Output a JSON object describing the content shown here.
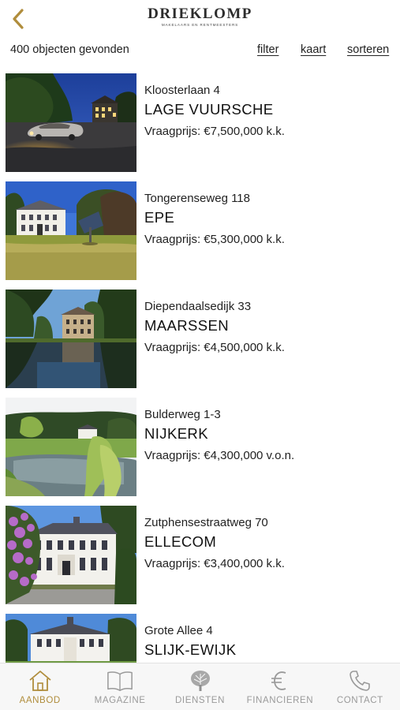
{
  "header": {
    "back_icon": "chevron-left-icon",
    "logo_title": "DRIEKLOMP",
    "logo_subtitle": "MAKELAARS EN RENTMEESTERS",
    "accent_color": "#b08d3c"
  },
  "toolbar": {
    "result_count": "400 objecten gevonden",
    "filter_label": "filter",
    "map_label": "kaart",
    "sort_label": "sorteren"
  },
  "listings": [
    {
      "street": "Kloosterlaan 4",
      "city": "LAGE VUURSCHE",
      "price": "Vraagprijs: €7,500,000 k.k."
    },
    {
      "street": "Tongerenseweg 118",
      "city": "EPE",
      "price": "Vraagprijs: €5,300,000 k.k."
    },
    {
      "street": "Diependaalsedijk 33",
      "city": "MAARSSEN",
      "price": "Vraagprijs: €4,500,000 k.k."
    },
    {
      "street": "Bulderweg 1-3",
      "city": "NIJKERK",
      "price": "Vraagprijs: €4,300,000 v.o.n."
    },
    {
      "street": "Zutphensestraatweg 70",
      "city": "ELLECOM",
      "price": "Vraagprijs: €3,400,000 k.k."
    },
    {
      "street": "Grote Allee 4",
      "city": "SLIJK-EWIJK",
      "price": ""
    }
  ],
  "bottom_nav": {
    "items": [
      {
        "label": "AANBOD",
        "icon": "home-icon",
        "active": true
      },
      {
        "label": "MAGAZINE",
        "icon": "book-icon",
        "active": false
      },
      {
        "label": "DIENSTEN",
        "icon": "tree-icon",
        "active": false
      },
      {
        "label": "FINANCIEREN",
        "icon": "euro-icon",
        "active": false
      },
      {
        "label": "CONTACT",
        "icon": "phone-icon",
        "active": false
      }
    ]
  }
}
